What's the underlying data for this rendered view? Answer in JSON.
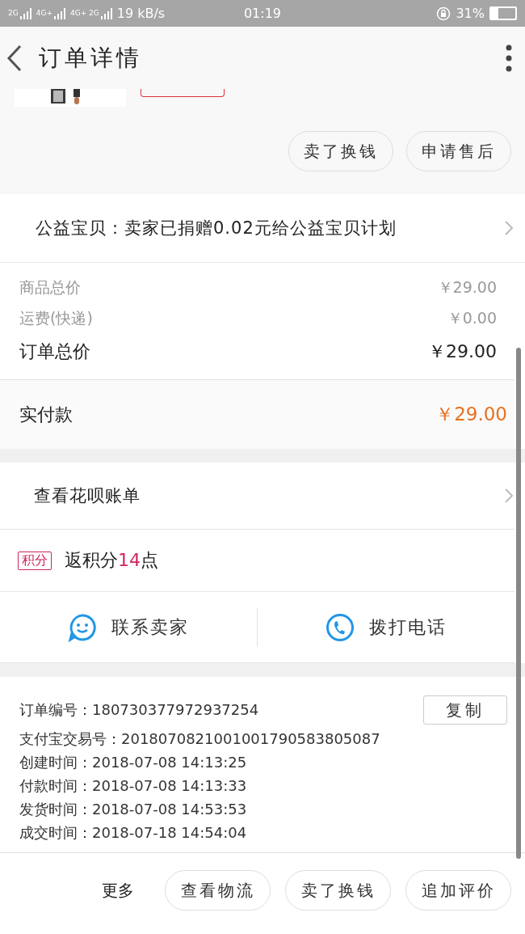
{
  "status_bar": {
    "networks": [
      "2G",
      "4G+",
      "4G+ 2G"
    ],
    "speed": "19 kB/s",
    "time": "01:19",
    "battery": "31%"
  },
  "header": {
    "title": "订单详情"
  },
  "product": {
    "kind": "picture"
  },
  "top_actions": [
    "卖了换钱",
    "申请售后"
  ],
  "charity": {
    "text": "公益宝贝：卖家已捐赠0.02元给公益宝贝计划"
  },
  "prices": [
    {
      "label": "商品总价",
      "value": "￥29.00",
      "kind": "minor"
    },
    {
      "label": "运费(快递)",
      "value": "￥0.00",
      "kind": "minor"
    },
    {
      "label": "订单总价",
      "value": "￥29.00",
      "kind": "major"
    }
  ],
  "paid": {
    "label": "实付款",
    "value": "￥29.00"
  },
  "huabei": {
    "text": "查看花呗账单"
  },
  "points": {
    "badge": "积分",
    "prefix": "返积分",
    "amount": "14",
    "suffix": "点"
  },
  "contacts": [
    {
      "label": "联系卖家",
      "kind": "chat"
    },
    {
      "label": "拨打电话",
      "kind": "phone"
    }
  ],
  "order_info": [
    {
      "label": "订单编号：",
      "value": "180730377972937254"
    },
    {
      "label": "支付宝交易号：",
      "value": "2018070821001001790583805087"
    },
    {
      "label": "创建时间：",
      "value": "2018-07-08 14:13:25"
    },
    {
      "label": "付款时间：",
      "value": "2018-07-08 14:13:33"
    },
    {
      "label": "发货时间：",
      "value": "2018-07-08 14:53:53"
    },
    {
      "label": "成交时间：",
      "value": "2018-07-18 14:54:04"
    }
  ],
  "copy_button": "复制",
  "bottom_bar": {
    "more": "更多",
    "buttons": [
      "查看物流",
      "卖了换钱",
      "追加评价"
    ]
  }
}
